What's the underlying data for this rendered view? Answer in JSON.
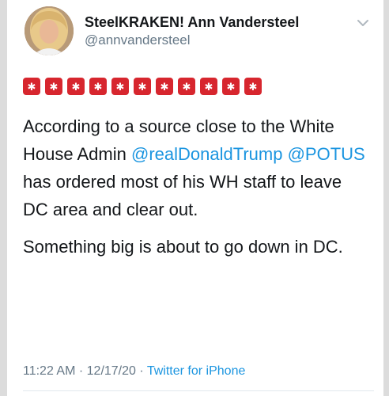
{
  "tweet": {
    "author": {
      "display_name": "SteelKRAKEN! Ann Vandersteel",
      "handle": "@annvandersteel"
    },
    "icons": {
      "avatar": "profile-photo",
      "menu": "chevron-down-icon",
      "emoji": "sos-emoji-icon"
    },
    "emoji_row": [
      "🆘",
      "🆘",
      "🆘",
      "🆘",
      "🆘",
      "🆘",
      "🆘",
      "🆘",
      "🆘",
      "🆘",
      "🆘"
    ],
    "paragraph1": {
      "line1": "According to a source close to the White House Admin",
      "mention1": "@realDonaldTrump",
      "mention2": "@POTUS",
      "rest": " has ordered most of his WH staff to leave DC area and clear out."
    },
    "paragraph2": "Something big is about to go down in DC.",
    "meta": {
      "time": "11:22 AM",
      "separator": " · ",
      "date": "12/17/20",
      "separator2": " · ",
      "source": "Twitter for iPhone"
    },
    "colors": {
      "link": "#1b95e0",
      "secondary_text": "#657786",
      "sos_red": "#d7262e"
    }
  }
}
